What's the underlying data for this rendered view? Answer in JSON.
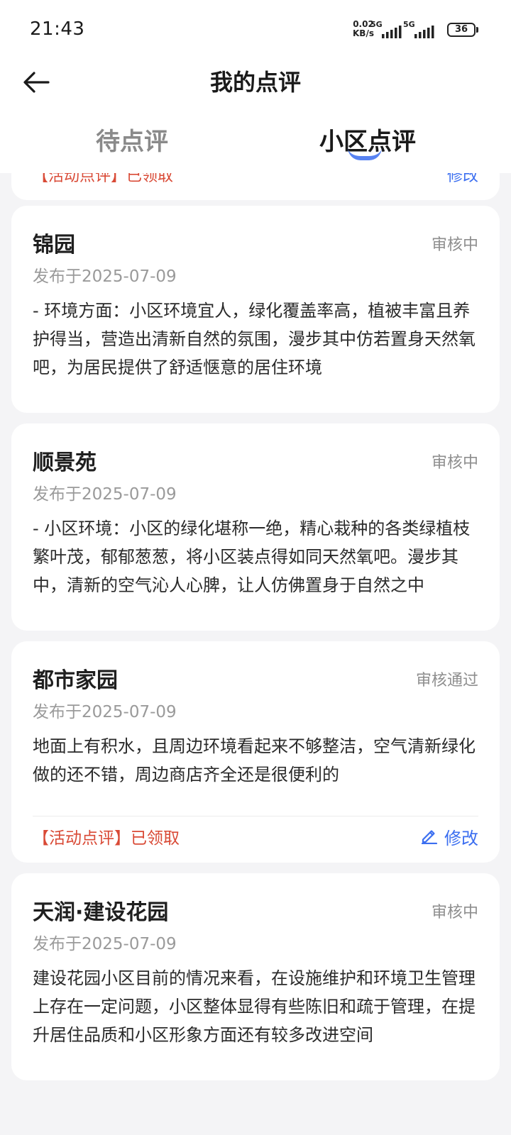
{
  "status_bar": {
    "time": "21:43",
    "net_speed_value": "0.02",
    "net_speed_unit": "KB/s",
    "signal1": "5G",
    "signal2": "5G",
    "battery": "36"
  },
  "header": {
    "title": "我的点评",
    "back_icon": "arrow-left-icon"
  },
  "tabs": [
    {
      "label": "待点评",
      "active": false
    },
    {
      "label": "小区点评",
      "active": true
    }
  ],
  "accent_color": "#3b6ef0",
  "activity_color": "#d94a36",
  "partial_card": {
    "activity": "【活动点评】已领取",
    "edit": "修改"
  },
  "reviews": [
    {
      "name": "锦园",
      "status": "审核中",
      "date": "发布于2025-07-09",
      "text": "- 环境方面：小区环境宜人，绿化覆盖率高，植被丰富且养护得当，营造出清新自然的氛围，漫步其中仿若置身天然氧吧，为居民提供了舒适惬意的居住环境"
    },
    {
      "name": "顺景苑",
      "status": "审核中",
      "date": "发布于2025-07-09",
      "text": "- 小区环境：小区的绿化堪称一绝，精心栽种的各类绿植枝繁叶茂，郁郁葱葱，将小区装点得如同天然氧吧。漫步其中，清新的空气沁人心脾，让人仿佛置身于自然之中"
    },
    {
      "name": "都市家园",
      "status": "审核通过",
      "date": "发布于2025-07-09",
      "text": "地面上有积水，且周边环境看起来不够整洁，空气清新绿化做的还不错，周边商店齐全还是很便利的",
      "activity": "【活动点评】已领取",
      "edit": "修改"
    },
    {
      "name": "天润·建设花园",
      "status": "审核中",
      "date": "发布于2025-07-09",
      "text": "建设花园小区目前的情况来看，在设施维护和环境卫生管理上存在一定问题，小区整体显得有些陈旧和疏于管理，在提升居住品质和小区形象方面还有较多改进空间"
    }
  ]
}
